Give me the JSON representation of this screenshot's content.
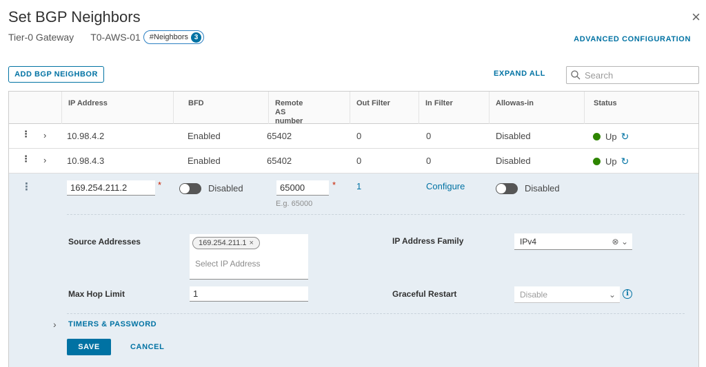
{
  "dialog": {
    "title": "Set BGP Neighbors",
    "gateway_type": "Tier-0 Gateway",
    "gateway_name": "T0-AWS-01",
    "neighbors_pill_label": "#Neighbors",
    "neighbors_count": "3",
    "close_icon": "×",
    "advanced_configuration": "ADVANCED CONFIGURATION"
  },
  "toolbar": {
    "add_neighbor": "ADD BGP NEIGHBOR",
    "expand_all": "EXPAND ALL",
    "search_placeholder": "Search"
  },
  "table": {
    "columns": [
      "IP Address",
      "BFD",
      "Remote AS number",
      "Out Filter",
      "In Filter",
      "Allowas-in",
      "Status"
    ],
    "rows": [
      {
        "ip": "10.98.4.2",
        "bfd": "Enabled",
        "remote_as": "65402",
        "out_filter": "0",
        "in_filter": "0",
        "allowas_in": "Disabled",
        "status": "Up"
      },
      {
        "ip": "10.98.4.3",
        "bfd": "Enabled",
        "remote_as": "65402",
        "out_filter": "0",
        "in_filter": "0",
        "allowas_in": "Disabled",
        "status": "Up"
      }
    ]
  },
  "edit_row": {
    "ip_value": "169.254.211.2",
    "bfd_label": "Disabled",
    "remote_as_value": "65000",
    "remote_as_hint": "E.g. 65000",
    "out_filter_link": "1",
    "in_filter_link": "Configure",
    "allowas_label": "Disabled",
    "required_mark": "*",
    "source_addresses_label": "Source Addresses",
    "source_address_chip": "169.254.211.1",
    "source_address_placeholder": "Select IP Address",
    "ip_family_label": "IP Address Family",
    "ip_family_value": "IPv4",
    "max_hop_label": "Max Hop Limit",
    "max_hop_value": "1",
    "graceful_restart_label": "Graceful Restart",
    "graceful_restart_value": "Disable",
    "timers_label": "TIMERS & PASSWORD",
    "save": "SAVE",
    "cancel": "CANCEL"
  },
  "colors": {
    "accent": "#0072a3",
    "status_up": "#2e8500",
    "required": "#c92100",
    "edit_background": "#e7eef4"
  }
}
